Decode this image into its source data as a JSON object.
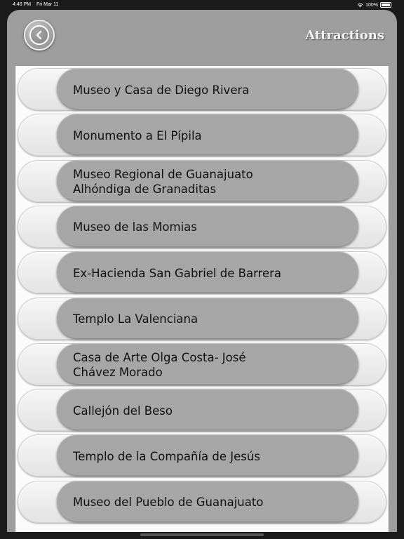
{
  "status_bar": {
    "time": "4:46 PM",
    "date": "Fri Mar 11",
    "battery": "100%"
  },
  "header": {
    "title": "Attractions",
    "back_icon": "chevron-left-icon"
  },
  "attractions": [
    "Museo y Casa de Diego Rivera",
    "Monumento a El Pípila",
    "Museo Regional de Guanajuato\nAlhóndiga de Granaditas",
    "Museo de las Momias",
    "Ex-Hacienda San Gabriel de Barrera",
    "Templo La Valenciana",
    "Casa de Arte Olga Costa- José\nChávez Morado",
    "Callejón del Beso",
    "Templo de la Compañía de Jesús",
    "Museo del Pueblo de Guanajuato"
  ],
  "colors": {
    "panel": "#9d9d9e",
    "pill": "#a6a6a6",
    "list_background": "#fbfbfb"
  }
}
